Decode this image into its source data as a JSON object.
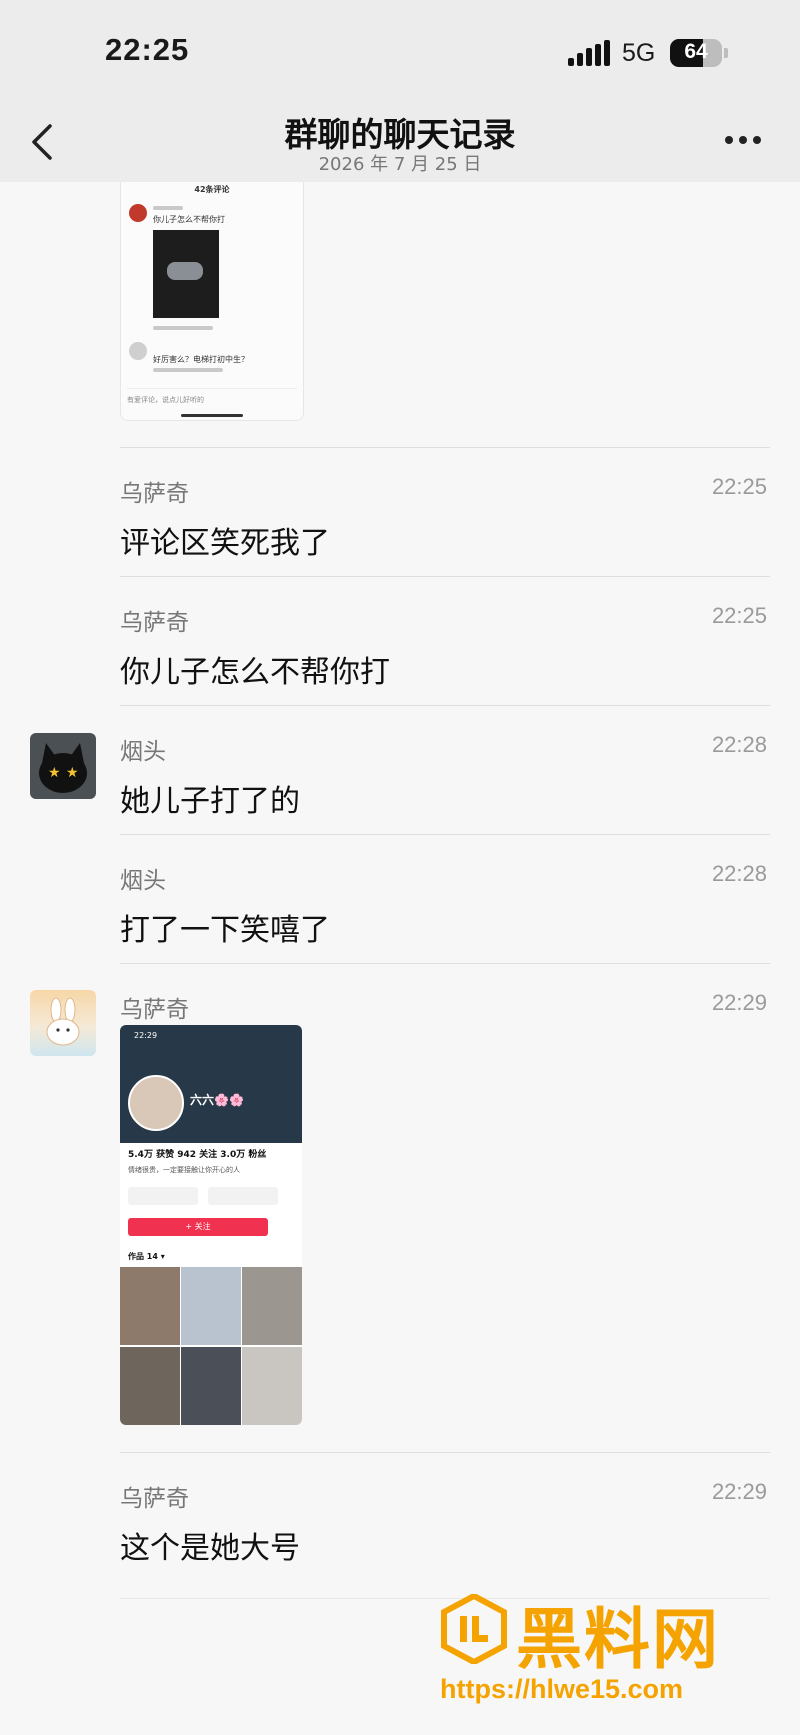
{
  "status_bar": {
    "time": "22:25",
    "network": "5G",
    "battery": "64",
    "battery_level": 0.64
  },
  "nav": {
    "title": "群聊的聊天记录",
    "subtitle": "2026 年 7 月 25 日"
  },
  "embedded_comment_screenshot": {
    "header": "42条评论",
    "comment_1": "你儿子怎么不帮你打",
    "comment_2": "好厉害么？电梯打初中生？",
    "input_placeholder": "有爱评论，说点儿好听的"
  },
  "messages": [
    {
      "sender": "乌萨奇",
      "time": "22:25",
      "text": "评论区笑死我了"
    },
    {
      "sender": "乌萨奇",
      "time": "22:25",
      "text": "你儿子怎么不帮你打"
    },
    {
      "sender": "烟头",
      "time": "22:28",
      "text": "她儿子打了的"
    },
    {
      "sender": "烟头",
      "time": "22:28",
      "text": "打了一下笑嘻了"
    },
    {
      "sender": "乌萨奇",
      "time": "22:29",
      "text": ""
    },
    {
      "sender": "乌萨奇",
      "time": "22:29",
      "text": "这个是她大号"
    }
  ],
  "embedded_profile_screenshot": {
    "time": "22:29",
    "name": "六六🌸🌸",
    "stats": "5.4万 获赞  942 关注  3.0万 粉丝",
    "bio": "情绪很贵，一定要接触让你开心的人",
    "follow_label": "+ 关注",
    "works_label": "作品 14 ▾"
  },
  "watermark": {
    "text": "黑料网",
    "url": "https://hlwe15.com"
  },
  "colors": {
    "accent": "#f5a300",
    "background": "#f7f7f7"
  }
}
